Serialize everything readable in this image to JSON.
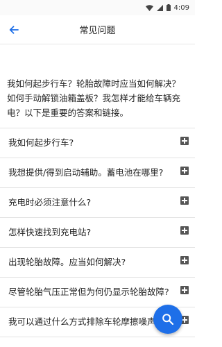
{
  "status_bar": {
    "time": "4:09"
  },
  "app_bar": {
    "title": "常见问题"
  },
  "intro_text": "我如何起步行车？轮胎故障时应当如何解决？如何手动解锁油箱盖板？我怎样才能给车辆充电？以下是重要的答案和链接。",
  "faq": [
    {
      "question": "我如何起步行车?"
    },
    {
      "question": "我想提供/得到启动辅助。蓄电池在哪里?"
    },
    {
      "question": "充电时必须注意什么?"
    },
    {
      "question": "怎样快速找到充电站?"
    },
    {
      "question": "出现轮胎故障。应当如何解决?"
    },
    {
      "question": "尽管轮胎气压正常但为何仍显示轮胎故障?"
    },
    {
      "question": "我可以通过什么方式排除车轮摩擦噪声?"
    }
  ],
  "colors": {
    "accent": "#1e6fe8",
    "icon_gray": "#555555",
    "divider": "#e2e2e2"
  },
  "icons": {
    "back": "arrow-left-icon",
    "expand": "plus-box-icon",
    "search": "search-icon"
  }
}
